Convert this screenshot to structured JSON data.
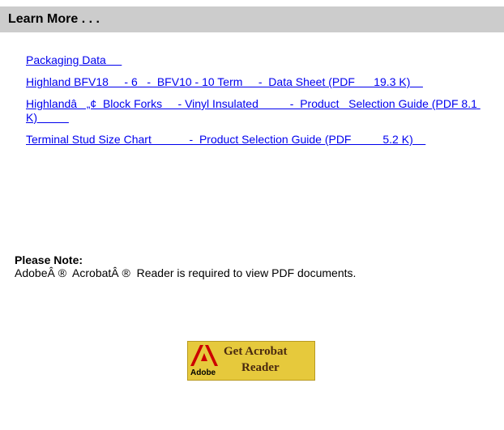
{
  "header": {
    "title": "Learn More . . ."
  },
  "links": [
    {
      "text": "Packaging Data     "
    },
    {
      "text": "Highland BFV18     - 6   -  BFV10 - 10 Term     -  Data Sheet (PDF      19.3 K)    "
    },
    {
      "text": "Highlandâ   „¢  Block Forks     - Vinyl Insulated          -  Product   Selection Guide (PDF 8.1 K)          "
    },
    {
      "text": "Terminal Stud Size Chart            -  Product Selection Guide (PDF          5.2 K)    "
    }
  ],
  "note": {
    "label": "Please Note:",
    "text": "AdobeÂ ®  AcrobatÂ ®  Reader is required to view PDF documents."
  },
  "acrobat_badge": {
    "line1": "Get Acrobat",
    "line2": "Reader",
    "brand": "Adobe",
    "icon": "adobe-logo-icon",
    "color": "#e6c93c",
    "logo_color": "#cc0000"
  },
  "colors": {
    "header_bg": "#cccccc",
    "link": "#0000ee"
  }
}
